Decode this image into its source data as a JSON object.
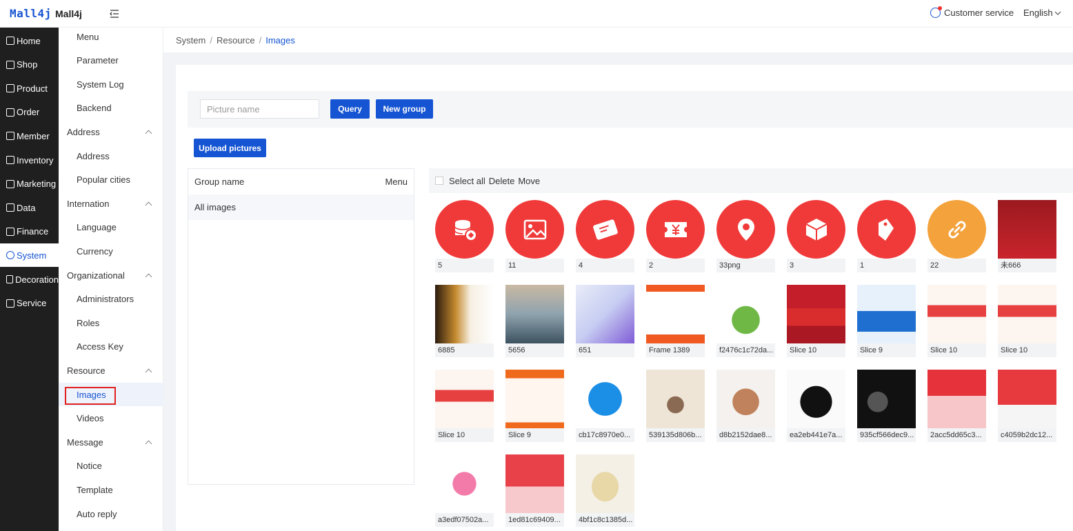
{
  "header": {
    "logo": "Mall4j",
    "brand": "Mall4j",
    "customer_service": "Customer service",
    "language": "English"
  },
  "rail": [
    {
      "label": "Home",
      "icon": "home-icon"
    },
    {
      "label": "Shop",
      "icon": "shop-icon"
    },
    {
      "label": "Product",
      "icon": "product-icon"
    },
    {
      "label": "Order",
      "icon": "order-icon"
    },
    {
      "label": "Member",
      "icon": "member-icon"
    },
    {
      "label": "Inventory",
      "icon": "inventory-icon"
    },
    {
      "label": "Marketing",
      "icon": "marketing-icon"
    },
    {
      "label": "Data",
      "icon": "data-icon"
    },
    {
      "label": "Finance",
      "icon": "finance-icon"
    },
    {
      "label": "System",
      "icon": "gear-icon",
      "active": true
    },
    {
      "label": "Decoration",
      "icon": "decoration-icon"
    },
    {
      "label": "Service",
      "icon": "service-icon"
    }
  ],
  "submenu": [
    {
      "label": "Menu",
      "type": "leaf"
    },
    {
      "label": "Parameter",
      "type": "leaf"
    },
    {
      "label": "System Log",
      "type": "leaf"
    },
    {
      "label": "Backend",
      "type": "leaf"
    },
    {
      "label": "Address",
      "type": "group"
    },
    {
      "label": "Address",
      "type": "leaf"
    },
    {
      "label": "Popular cities",
      "type": "leaf"
    },
    {
      "label": "Internation",
      "type": "group"
    },
    {
      "label": "Language",
      "type": "leaf"
    },
    {
      "label": "Currency",
      "type": "leaf"
    },
    {
      "label": "Organizational",
      "type": "group"
    },
    {
      "label": "Administrators",
      "type": "leaf"
    },
    {
      "label": "Roles",
      "type": "leaf"
    },
    {
      "label": "Access Key",
      "type": "leaf"
    },
    {
      "label": "Resource",
      "type": "group"
    },
    {
      "label": "Images",
      "type": "leaf",
      "active": true
    },
    {
      "label": "Videos",
      "type": "leaf"
    },
    {
      "label": "Message",
      "type": "group"
    },
    {
      "label": "Notice",
      "type": "leaf"
    },
    {
      "label": "Template",
      "type": "leaf"
    },
    {
      "label": "Auto reply",
      "type": "leaf"
    }
  ],
  "breadcrumb": [
    "System",
    "Resource",
    "Images"
  ],
  "search": {
    "placeholder": "Picture name",
    "value": ""
  },
  "buttons": {
    "query": "Query",
    "new_group": "New group",
    "upload": "Upload pictures"
  },
  "groups": {
    "header_name": "Group name",
    "header_menu": "Menu",
    "rows": [
      "All images"
    ]
  },
  "image_toolbar": {
    "select_all": "Select all",
    "delete": "Delete",
    "move": "Move"
  },
  "images": [
    {
      "name": "5",
      "kind": "icon",
      "icon": "database-icon",
      "color": "#f03a3a"
    },
    {
      "name": "11",
      "kind": "icon",
      "icon": "image-icon",
      "color": "#f03a3a"
    },
    {
      "name": "4",
      "kind": "icon",
      "icon": "ticket-icon",
      "color": "#f03a3a"
    },
    {
      "name": "2",
      "kind": "icon",
      "icon": "yen-coupon-icon",
      "color": "#f03a3a"
    },
    {
      "name": "33png",
      "kind": "icon",
      "icon": "location-pin-icon",
      "color": "#f03a3a"
    },
    {
      "name": "3",
      "kind": "icon",
      "icon": "box-icon",
      "color": "#f03a3a"
    },
    {
      "name": "1",
      "kind": "icon",
      "icon": "tag-icon",
      "color": "#f03a3a"
    },
    {
      "name": "22",
      "kind": "icon",
      "icon": "link-icon",
      "color": "#f4a23c"
    },
    {
      "name": "未666",
      "kind": "photo",
      "theme": "ysl-red"
    },
    {
      "name": "6885",
      "kind": "photo",
      "theme": "ysl-bottles"
    },
    {
      "name": "5656",
      "kind": "photo",
      "theme": "sea-gloss"
    },
    {
      "name": "651",
      "kind": "photo",
      "theme": "save-50"
    },
    {
      "name": "Frame 1389",
      "kind": "photo",
      "theme": "announcement"
    },
    {
      "name": "f2476c1c72da...",
      "kind": "photo",
      "theme": "landscape"
    },
    {
      "name": "Slice 10",
      "kind": "photo",
      "theme": "christmas"
    },
    {
      "name": "Slice 9",
      "kind": "photo",
      "theme": "mid-year"
    },
    {
      "name": "Slice 10",
      "kind": "photo",
      "theme": "app-grid"
    },
    {
      "name": "Slice 10",
      "kind": "photo",
      "theme": "app-grid"
    },
    {
      "name": "Slice 10",
      "kind": "photo",
      "theme": "app-grid"
    },
    {
      "name": "Slice 9",
      "kind": "photo",
      "theme": "notice"
    },
    {
      "name": "cb17c8970e0...",
      "kind": "photo",
      "theme": "blue-logo"
    },
    {
      "name": "539135d806b...",
      "kind": "photo",
      "theme": "cream-jar"
    },
    {
      "name": "d8b2152dae8...",
      "kind": "photo",
      "theme": "gold-jar"
    },
    {
      "name": "ea2eb441e7a...",
      "kind": "photo",
      "theme": "black-jar"
    },
    {
      "name": "935cf566dec9...",
      "kind": "photo",
      "theme": "black-jars"
    },
    {
      "name": "2acc5dd65c3...",
      "kind": "photo",
      "theme": "pink-drink"
    },
    {
      "name": "c4059b2dc12...",
      "kind": "photo",
      "theme": "red-can"
    },
    {
      "name": "a3edf07502a...",
      "kind": "photo",
      "theme": "can-white"
    },
    {
      "name": "1ed81c69409...",
      "kind": "photo",
      "theme": "red-drinks"
    },
    {
      "name": "4bf1c8c1385d...",
      "kind": "photo",
      "theme": "toaster"
    }
  ],
  "colors": {
    "primary": "#1554d2",
    "rail_bg": "#1f1f1f",
    "icon_red": "#f03a3a",
    "icon_orange": "#f4a23c",
    "highlight_border": "#e02020"
  }
}
